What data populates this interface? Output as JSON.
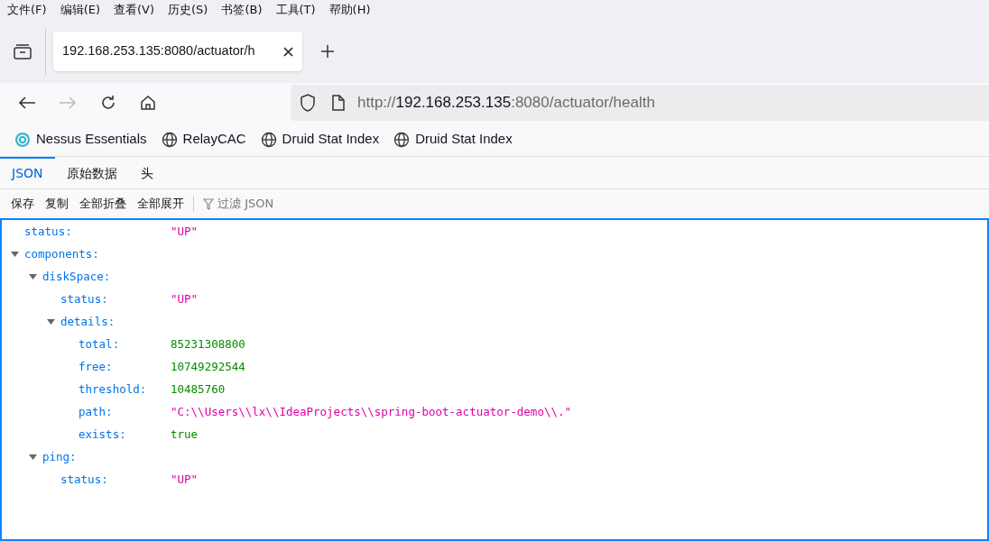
{
  "menu_bar": [
    "文件(F)",
    "编辑(E)",
    "查看(V)",
    "历史(S)",
    "书签(B)",
    "工具(T)",
    "帮助(H)"
  ],
  "tabs": [
    {
      "title": "192.168.253.135:8080/actuator/h",
      "selected": true
    }
  ],
  "address_bar": {
    "scheme": "http://",
    "host": "192.168.253.135",
    "rest": ":8080/actuator/health"
  },
  "bookmarks": [
    {
      "label": "Nessus Essentials",
      "kind": "nessus"
    },
    {
      "label": "RelayCAC",
      "kind": "globe"
    },
    {
      "label": "Druid Stat Index",
      "kind": "globe"
    },
    {
      "label": "Druid Stat Index",
      "kind": "globe"
    }
  ],
  "viewer_tabs": [
    {
      "label": "JSON",
      "selected": true
    },
    {
      "label": "原始数据",
      "selected": false
    },
    {
      "label": "头",
      "selected": false
    }
  ],
  "toolbar": {
    "buttons": [
      "保存",
      "复制",
      "全部折叠",
      "全部展开"
    ],
    "filter_placeholder": "过滤 JSON"
  },
  "tree": [
    {
      "key": "status:",
      "value": "\"UP\"",
      "kind": "string"
    },
    {
      "key": "components:",
      "expanded": true,
      "children": [
        {
          "key": "diskSpace:",
          "expanded": true,
          "children": [
            {
              "key": "status:",
              "value": "\"UP\"",
              "kind": "string"
            },
            {
              "key": "details:",
              "expanded": true,
              "children": [
                {
                  "key": "total:",
                  "value": "85231308800",
                  "kind": "number"
                },
                {
                  "key": "free:",
                  "value": "10749292544",
                  "kind": "number"
                },
                {
                  "key": "threshold:",
                  "value": "10485760",
                  "kind": "number"
                },
                {
                  "key": "path:",
                  "value": "\"C:\\\\Users\\\\lx\\\\IdeaProjects\\\\spring-boot-actuator-demo\\\\.\"",
                  "kind": "string"
                },
                {
                  "key": "exists:",
                  "value": "true",
                  "kind": "boolean"
                }
              ]
            }
          ]
        },
        {
          "key": "ping:",
          "expanded": true,
          "children": [
            {
              "key": "status:",
              "value": "\"UP\"",
              "kind": "string"
            }
          ]
        }
      ]
    }
  ]
}
